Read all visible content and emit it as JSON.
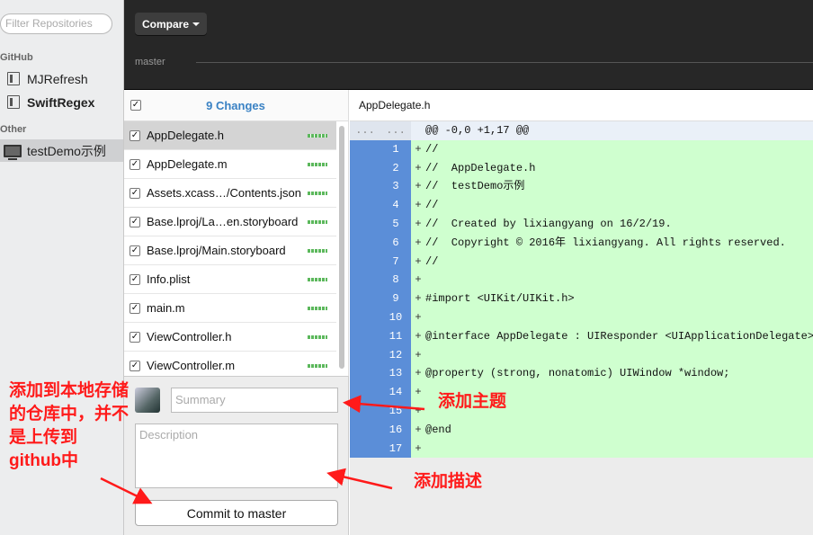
{
  "sidebar": {
    "filter_placeholder": "Filter Repositories",
    "groups": [
      {
        "label": "GitHub",
        "repos": [
          "MJRefresh",
          "SwiftRegex"
        ]
      },
      {
        "label": "Other",
        "repos": [
          "testDemo示例"
        ]
      }
    ]
  },
  "toolbar": {
    "compare_label": "Compare",
    "branch": "master"
  },
  "changes": {
    "count_label": "9 Changes",
    "check": "✓",
    "files": [
      "AppDelegate.h",
      "AppDelegate.m",
      "Assets.xcass…/Contents.json",
      "Base.lproj/La…en.storyboard",
      "Base.lproj/Main.storyboard",
      "Info.plist",
      "main.m",
      "ViewController.h",
      "ViewController.m"
    ]
  },
  "commit": {
    "summary_placeholder": "Summary",
    "description_placeholder": "Description",
    "button_label": "Commit to master"
  },
  "diff": {
    "filename": "AppDelegate.h",
    "hunk": {
      "n1": "...",
      "n2": "...",
      "code": "@@ -0,0 +1,17 @@"
    },
    "lines": [
      {
        "n": "1",
        "sign": "+",
        "code": "//"
      },
      {
        "n": "2",
        "sign": "+",
        "code": "//  AppDelegate.h"
      },
      {
        "n": "3",
        "sign": "+",
        "code": "//  testDemo示例"
      },
      {
        "n": "4",
        "sign": "+",
        "code": "//"
      },
      {
        "n": "5",
        "sign": "+",
        "code": "//  Created by lixiangyang on 16/2/19."
      },
      {
        "n": "6",
        "sign": "+",
        "code": "//  Copyright © 2016年 lixiangyang. All rights reserved."
      },
      {
        "n": "7",
        "sign": "+",
        "code": "//"
      },
      {
        "n": "8",
        "sign": "+",
        "code": ""
      },
      {
        "n": "9",
        "sign": "+",
        "code": "#import <UIKit/UIKit.h>"
      },
      {
        "n": "10",
        "sign": "+",
        "code": ""
      },
      {
        "n": "11",
        "sign": "+",
        "code": "@interface AppDelegate : UIResponder <UIApplicationDelegate>"
      },
      {
        "n": "12",
        "sign": "+",
        "code": ""
      },
      {
        "n": "13",
        "sign": "+",
        "code": "@property (strong, nonatomic) UIWindow *window;"
      },
      {
        "n": "14",
        "sign": "+",
        "code": ""
      },
      {
        "n": "15",
        "sign": "+",
        "code": ""
      },
      {
        "n": "16",
        "sign": "+",
        "code": "@end"
      },
      {
        "n": "17",
        "sign": "+",
        "code": ""
      }
    ]
  },
  "annotations": {
    "left": [
      "添加到本地存储",
      "的仓库中，并不",
      "是上传到",
      "github中"
    ],
    "summary": "添加主题",
    "description": "添加描述"
  },
  "colors": {
    "annotation": "#ff1a1a",
    "added_line": "#cfffcf",
    "line_number": "#5b8ed8",
    "changes_link": "#3a82c4"
  }
}
